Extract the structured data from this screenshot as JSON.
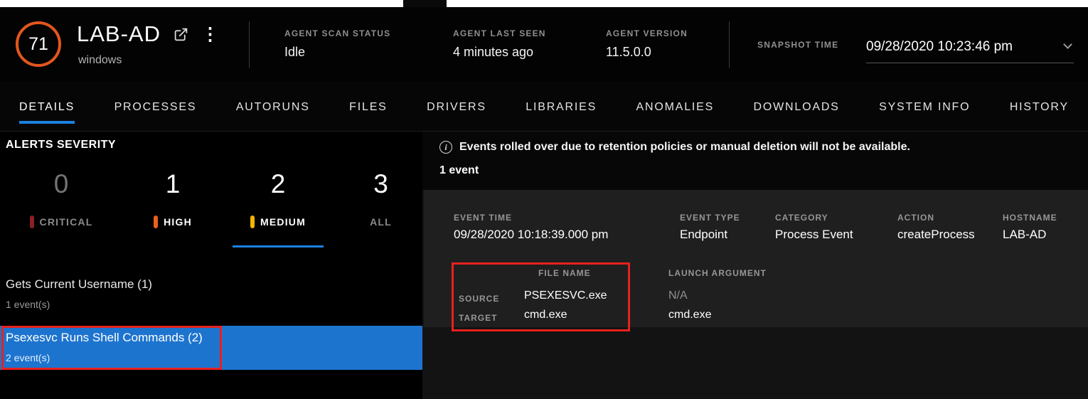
{
  "header": {
    "risk_score": "71",
    "hostname": "LAB-AD",
    "os": "windows",
    "stats": [
      {
        "label": "AGENT SCAN STATUS",
        "value": "Idle"
      },
      {
        "label": "AGENT LAST SEEN",
        "value": "4 minutes ago"
      },
      {
        "label": "AGENT VERSION",
        "value": "11.5.0.0"
      }
    ],
    "snapshot": {
      "label": "SNAPSHOT TIME",
      "value": "09/28/2020 10:23:46 pm"
    }
  },
  "tabs": [
    {
      "label": "DETAILS",
      "active": true
    },
    {
      "label": "PROCESSES",
      "active": false
    },
    {
      "label": "AUTORUNS",
      "active": false
    },
    {
      "label": "FILES",
      "active": false
    },
    {
      "label": "DRIVERS",
      "active": false
    },
    {
      "label": "LIBRARIES",
      "active": false
    },
    {
      "label": "ANOMALIES",
      "active": false
    },
    {
      "label": "DOWNLOADS",
      "active": false
    },
    {
      "label": "SYSTEM INFO",
      "active": false
    },
    {
      "label": "HISTORY",
      "active": false
    }
  ],
  "alerts": {
    "title": "ALERTS SEVERITY",
    "severities": [
      {
        "count": "0",
        "label": "CRITICAL",
        "bar_color": "#8c2020",
        "selected": false
      },
      {
        "count": "1",
        "label": "HIGH",
        "bar_color": "#e8611c",
        "selected": false
      },
      {
        "count": "2",
        "label": "MEDIUM",
        "bar_color": "#f2b600",
        "selected": true
      },
      {
        "count": "3",
        "label": "ALL",
        "bar_color": "",
        "selected": false
      }
    ],
    "items": [
      {
        "title": "Gets Current Username (1)",
        "subtitle": "1 event(s)",
        "selected": false
      },
      {
        "title": "Psexesvc Runs Shell Commands (2)",
        "subtitle": "2 event(s)",
        "selected": true
      }
    ]
  },
  "events": {
    "notice": "Events rolled over due to retention policies or manual deletion will not be available.",
    "count_label": "1 event",
    "event": {
      "fields": [
        {
          "label": "EVENT TIME",
          "value": "09/28/2020 10:18:39.000 pm"
        },
        {
          "label": "EVENT TYPE",
          "value": "Endpoint"
        },
        {
          "label": "CATEGORY",
          "value": "Process Event"
        },
        {
          "label": "ACTION",
          "value": "createProcess"
        },
        {
          "label": "HOSTNAME",
          "value": "LAB-AD"
        }
      ],
      "file_name": {
        "header": "FILE NAME",
        "rows": [
          {
            "label": "SOURCE",
            "value": "PSEXESVC.exe"
          },
          {
            "label": "TARGET",
            "value": "cmd.exe"
          }
        ]
      },
      "launch_argument": {
        "label": "LAUNCH ARGUMENT",
        "values": [
          "N/A",
          "cmd.exe"
        ]
      }
    }
  },
  "icons": {
    "kebab_menu": "⋮",
    "info": "i"
  },
  "colors": {
    "risk_orange": "#e2571c",
    "accent_blue": "#1d80e0",
    "selected_row_blue": "#1d74cf",
    "annotation_red": "#e8211d",
    "critical_bar": "#8c2020",
    "high_bar": "#e8611c",
    "medium_bar": "#f2b600"
  }
}
